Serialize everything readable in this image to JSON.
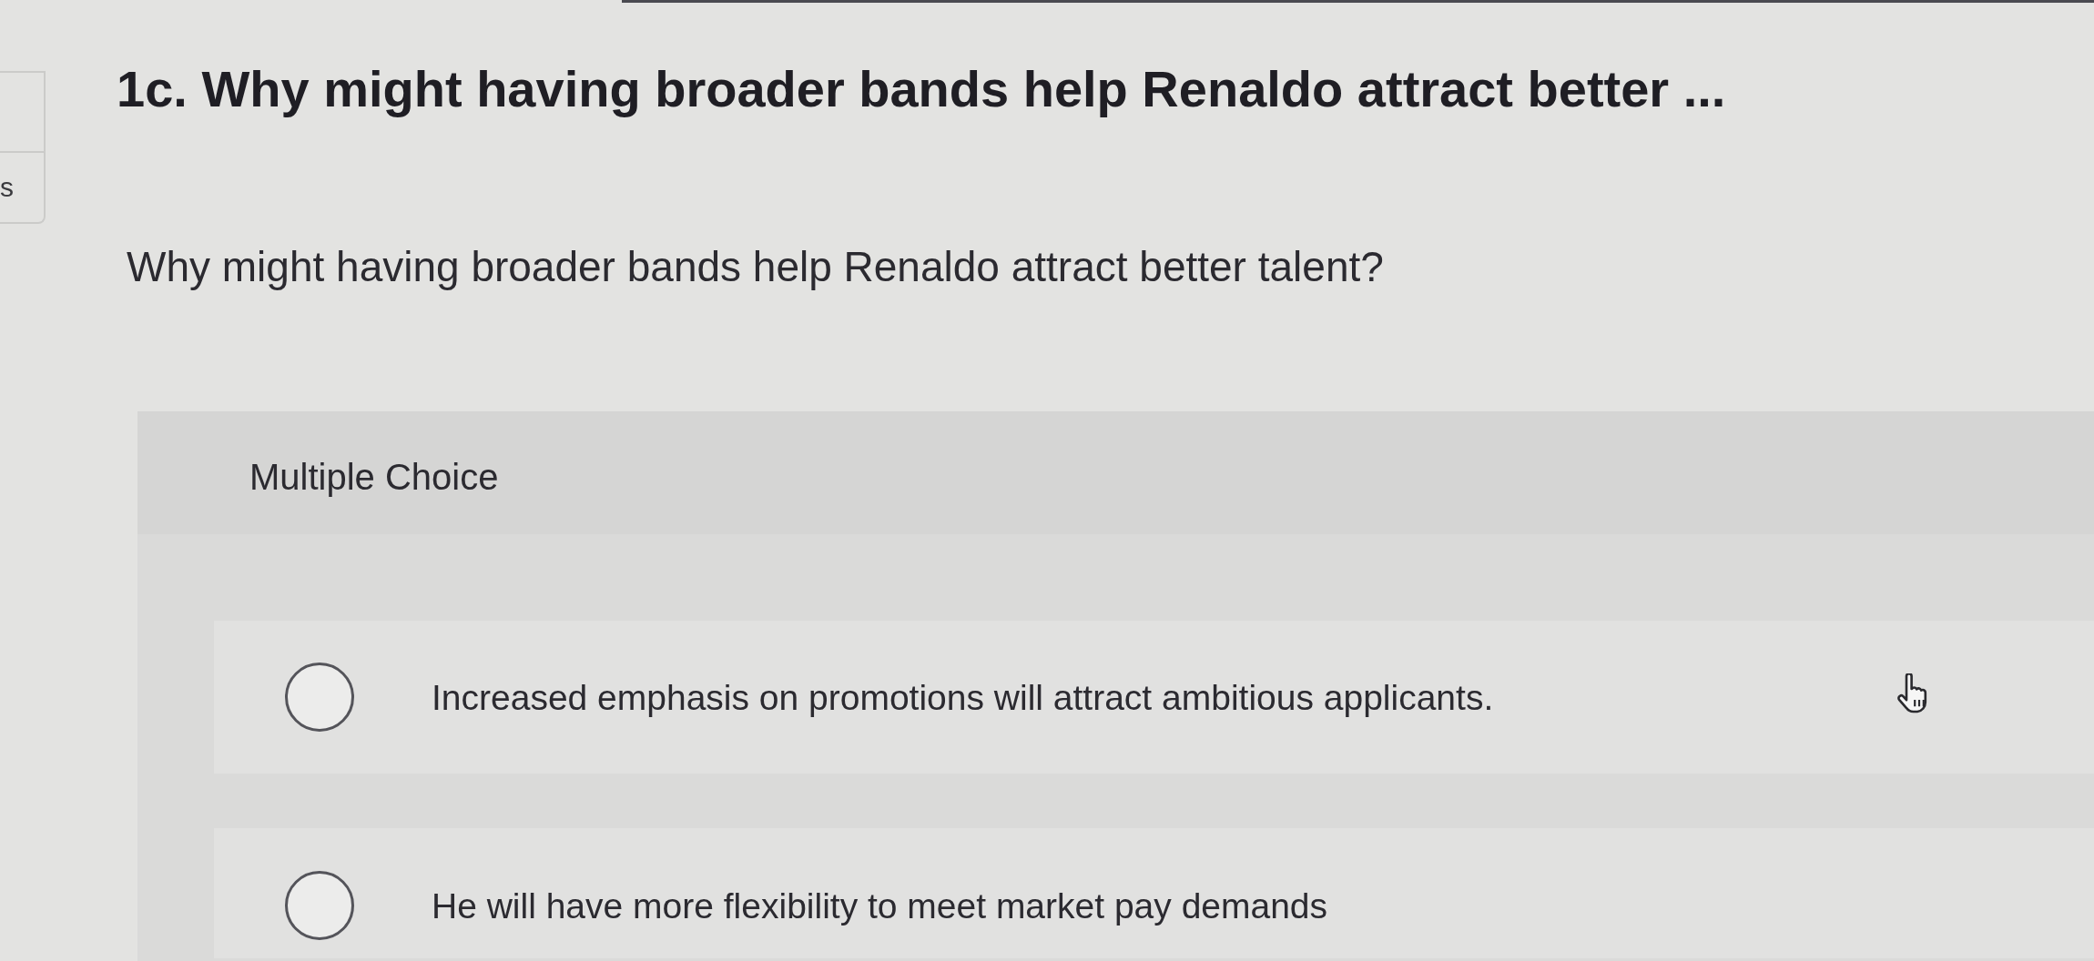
{
  "sidebar_card": {
    "label": "s"
  },
  "question": {
    "title": "1c. Why might having broader bands help Renaldo attract better ...",
    "prompt": "Why might having broader bands help Renaldo attract better talent?"
  },
  "answer_panel": {
    "type_label": "Multiple Choice",
    "options": [
      {
        "label": "Increased emphasis on promotions will attract ambitious applicants.",
        "selected": false
      },
      {
        "label": "He will have more flexibility to meet market pay demands",
        "selected": false
      }
    ]
  }
}
